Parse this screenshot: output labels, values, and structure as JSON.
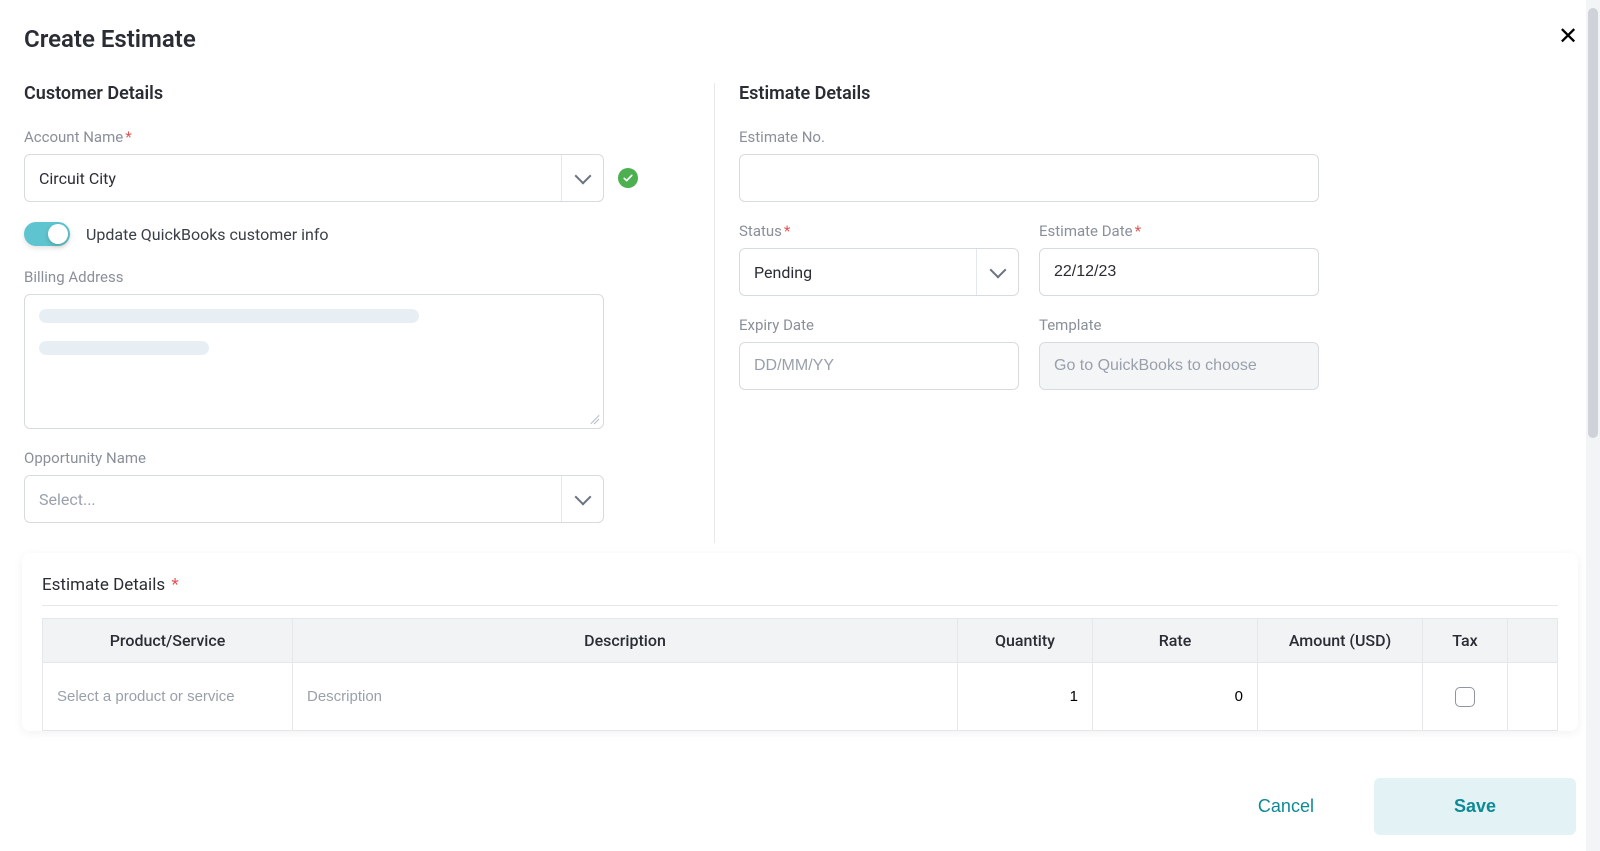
{
  "header": {
    "title": "Create Estimate"
  },
  "customer": {
    "heading": "Customer Details",
    "account_label": "Account Name",
    "account_value": "Circuit City",
    "toggle_label": "Update QuickBooks customer info",
    "toggle_on": true,
    "billing_label": "Billing Address",
    "opportunity_label": "Opportunity Name",
    "opportunity_placeholder": "Select..."
  },
  "estimate": {
    "heading": "Estimate Details",
    "no_label": "Estimate No.",
    "no_value": "",
    "status_label": "Status",
    "status_value": "Pending",
    "date_label": "Estimate Date",
    "date_value": "22/12/23",
    "expiry_label": "Expiry Date",
    "expiry_placeholder": "DD/MM/YY",
    "template_label": "Template",
    "template_placeholder": "Go to QuickBooks to choose"
  },
  "lines": {
    "heading": "Estimate Details",
    "cols": {
      "product": "Product/Service",
      "description": "Description",
      "quantity": "Quantity",
      "rate": "Rate",
      "amount": "Amount (USD)",
      "tax": "Tax"
    },
    "row": {
      "product_placeholder": "Select a product or service",
      "description_placeholder": "Description",
      "quantity": "1",
      "rate": "0",
      "amount": "",
      "tax": false
    }
  },
  "footer": {
    "cancel": "Cancel",
    "save": "Save"
  },
  "colors": {
    "accent": "#0e8a96"
  }
}
